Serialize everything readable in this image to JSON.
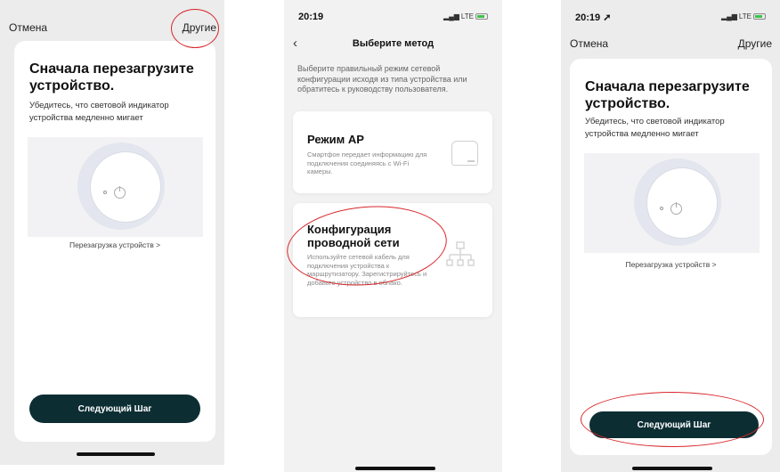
{
  "screen1": {
    "cancel": "Отмена",
    "others": "Другие",
    "title": "Сначала перезагрузите устройство.",
    "subtitle": "Убедитесь, что световой индикатор устройства медленно мигает",
    "reset_link": "Перезагрузка устройств >",
    "next_button": "Следующий Шаг"
  },
  "screen2": {
    "time": "20:19",
    "network": "LTE",
    "back": "‹",
    "title": "Выберите метод",
    "intro": "Выберите правильный режим сетевой конфигурации исходя из типа устройства или обратитесь к руководству пользователя.",
    "option_ap": {
      "title": "Режим AP",
      "desc": "Смартфон передает информацию для подключения соединяясь с Wi-Fi камеры."
    },
    "option_wired": {
      "title": "Конфигурация проводной сети",
      "desc": "Используйте сетевой кабель для подключения устройства к маршрутизатору. Зарегистрируйтесь и добавьте устройство в облако."
    }
  },
  "screen3": {
    "time": "20:19 ➚",
    "network": "LTE",
    "cancel": "Отмена",
    "others": "Другие",
    "title": "Сначала перезагрузите устройство.",
    "subtitle": "Убедитесь, что световой индикатор устройства медленно мигает",
    "reset_link": "Перезагрузка устройств >",
    "next_button": "Следующий Шаг"
  },
  "colors": {
    "button": "#0c2e33",
    "annotation": "#d8262a"
  }
}
